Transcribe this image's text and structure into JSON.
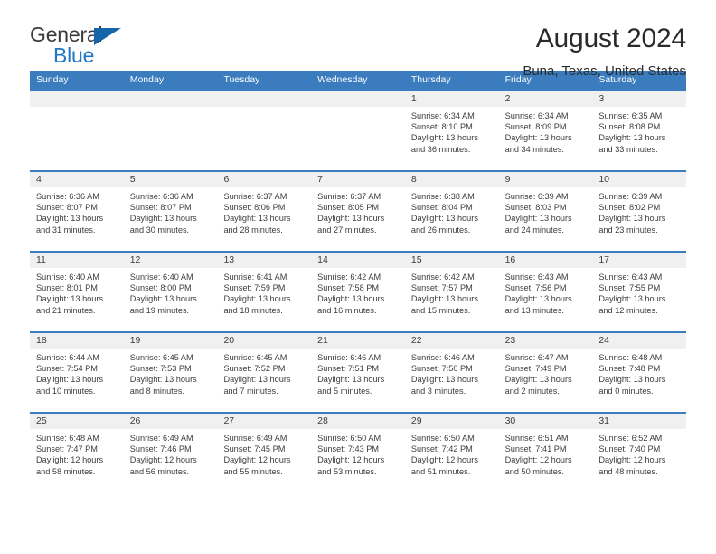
{
  "brand": {
    "line1": "General",
    "line2": "Blue",
    "triangle_icon": "triangle-icon",
    "color_text": "#3a3a3a",
    "color_blue": "#2277c8"
  },
  "header": {
    "title": "August 2024",
    "location": "Buna, Texas, United States"
  },
  "theme": {
    "header_bar": "#3a7cbe",
    "daynum_band": "#f0f0f0",
    "text": "#3c3c3c"
  },
  "weekdays": [
    "Sunday",
    "Monday",
    "Tuesday",
    "Wednesday",
    "Thursday",
    "Friday",
    "Saturday"
  ],
  "labels": {
    "sunrise_prefix": "Sunrise:",
    "sunset_prefix": "Sunset:",
    "daylight_prefix": "Daylight:"
  },
  "weeks": [
    [
      {
        "day": "",
        "empty": true
      },
      {
        "day": "",
        "empty": true
      },
      {
        "day": "",
        "empty": true
      },
      {
        "day": "",
        "empty": true
      },
      {
        "day": "1",
        "l1": "Sunrise: 6:34 AM",
        "l2": "Sunset: 8:10 PM",
        "l3": "Daylight: 13 hours",
        "l4": "and 36 minutes."
      },
      {
        "day": "2",
        "l1": "Sunrise: 6:34 AM",
        "l2": "Sunset: 8:09 PM",
        "l3": "Daylight: 13 hours",
        "l4": "and 34 minutes."
      },
      {
        "day": "3",
        "l1": "Sunrise: 6:35 AM",
        "l2": "Sunset: 8:08 PM",
        "l3": "Daylight: 13 hours",
        "l4": "and 33 minutes."
      }
    ],
    [
      {
        "day": "4",
        "l1": "Sunrise: 6:36 AM",
        "l2": "Sunset: 8:07 PM",
        "l3": "Daylight: 13 hours",
        "l4": "and 31 minutes."
      },
      {
        "day": "5",
        "l1": "Sunrise: 6:36 AM",
        "l2": "Sunset: 8:07 PM",
        "l3": "Daylight: 13 hours",
        "l4": "and 30 minutes."
      },
      {
        "day": "6",
        "l1": "Sunrise: 6:37 AM",
        "l2": "Sunset: 8:06 PM",
        "l3": "Daylight: 13 hours",
        "l4": "and 28 minutes."
      },
      {
        "day": "7",
        "l1": "Sunrise: 6:37 AM",
        "l2": "Sunset: 8:05 PM",
        "l3": "Daylight: 13 hours",
        "l4": "and 27 minutes."
      },
      {
        "day": "8",
        "l1": "Sunrise: 6:38 AM",
        "l2": "Sunset: 8:04 PM",
        "l3": "Daylight: 13 hours",
        "l4": "and 26 minutes."
      },
      {
        "day": "9",
        "l1": "Sunrise: 6:39 AM",
        "l2": "Sunset: 8:03 PM",
        "l3": "Daylight: 13 hours",
        "l4": "and 24 minutes."
      },
      {
        "day": "10",
        "l1": "Sunrise: 6:39 AM",
        "l2": "Sunset: 8:02 PM",
        "l3": "Daylight: 13 hours",
        "l4": "and 23 minutes."
      }
    ],
    [
      {
        "day": "11",
        "l1": "Sunrise: 6:40 AM",
        "l2": "Sunset: 8:01 PM",
        "l3": "Daylight: 13 hours",
        "l4": "and 21 minutes."
      },
      {
        "day": "12",
        "l1": "Sunrise: 6:40 AM",
        "l2": "Sunset: 8:00 PM",
        "l3": "Daylight: 13 hours",
        "l4": "and 19 minutes."
      },
      {
        "day": "13",
        "l1": "Sunrise: 6:41 AM",
        "l2": "Sunset: 7:59 PM",
        "l3": "Daylight: 13 hours",
        "l4": "and 18 minutes."
      },
      {
        "day": "14",
        "l1": "Sunrise: 6:42 AM",
        "l2": "Sunset: 7:58 PM",
        "l3": "Daylight: 13 hours",
        "l4": "and 16 minutes."
      },
      {
        "day": "15",
        "l1": "Sunrise: 6:42 AM",
        "l2": "Sunset: 7:57 PM",
        "l3": "Daylight: 13 hours",
        "l4": "and 15 minutes."
      },
      {
        "day": "16",
        "l1": "Sunrise: 6:43 AM",
        "l2": "Sunset: 7:56 PM",
        "l3": "Daylight: 13 hours",
        "l4": "and 13 minutes."
      },
      {
        "day": "17",
        "l1": "Sunrise: 6:43 AM",
        "l2": "Sunset: 7:55 PM",
        "l3": "Daylight: 13 hours",
        "l4": "and 12 minutes."
      }
    ],
    [
      {
        "day": "18",
        "l1": "Sunrise: 6:44 AM",
        "l2": "Sunset: 7:54 PM",
        "l3": "Daylight: 13 hours",
        "l4": "and 10 minutes."
      },
      {
        "day": "19",
        "l1": "Sunrise: 6:45 AM",
        "l2": "Sunset: 7:53 PM",
        "l3": "Daylight: 13 hours",
        "l4": "and 8 minutes."
      },
      {
        "day": "20",
        "l1": "Sunrise: 6:45 AM",
        "l2": "Sunset: 7:52 PM",
        "l3": "Daylight: 13 hours",
        "l4": "and 7 minutes."
      },
      {
        "day": "21",
        "l1": "Sunrise: 6:46 AM",
        "l2": "Sunset: 7:51 PM",
        "l3": "Daylight: 13 hours",
        "l4": "and 5 minutes."
      },
      {
        "day": "22",
        "l1": "Sunrise: 6:46 AM",
        "l2": "Sunset: 7:50 PM",
        "l3": "Daylight: 13 hours",
        "l4": "and 3 minutes."
      },
      {
        "day": "23",
        "l1": "Sunrise: 6:47 AM",
        "l2": "Sunset: 7:49 PM",
        "l3": "Daylight: 13 hours",
        "l4": "and 2 minutes."
      },
      {
        "day": "24",
        "l1": "Sunrise: 6:48 AM",
        "l2": "Sunset: 7:48 PM",
        "l3": "Daylight: 13 hours",
        "l4": "and 0 minutes."
      }
    ],
    [
      {
        "day": "25",
        "l1": "Sunrise: 6:48 AM",
        "l2": "Sunset: 7:47 PM",
        "l3": "Daylight: 12 hours",
        "l4": "and 58 minutes."
      },
      {
        "day": "26",
        "l1": "Sunrise: 6:49 AM",
        "l2": "Sunset: 7:46 PM",
        "l3": "Daylight: 12 hours",
        "l4": "and 56 minutes."
      },
      {
        "day": "27",
        "l1": "Sunrise: 6:49 AM",
        "l2": "Sunset: 7:45 PM",
        "l3": "Daylight: 12 hours",
        "l4": "and 55 minutes."
      },
      {
        "day": "28",
        "l1": "Sunrise: 6:50 AM",
        "l2": "Sunset: 7:43 PM",
        "l3": "Daylight: 12 hours",
        "l4": "and 53 minutes."
      },
      {
        "day": "29",
        "l1": "Sunrise: 6:50 AM",
        "l2": "Sunset: 7:42 PM",
        "l3": "Daylight: 12 hours",
        "l4": "and 51 minutes."
      },
      {
        "day": "30",
        "l1": "Sunrise: 6:51 AM",
        "l2": "Sunset: 7:41 PM",
        "l3": "Daylight: 12 hours",
        "l4": "and 50 minutes."
      },
      {
        "day": "31",
        "l1": "Sunrise: 6:52 AM",
        "l2": "Sunset: 7:40 PM",
        "l3": "Daylight: 12 hours",
        "l4": "and 48 minutes."
      }
    ]
  ]
}
